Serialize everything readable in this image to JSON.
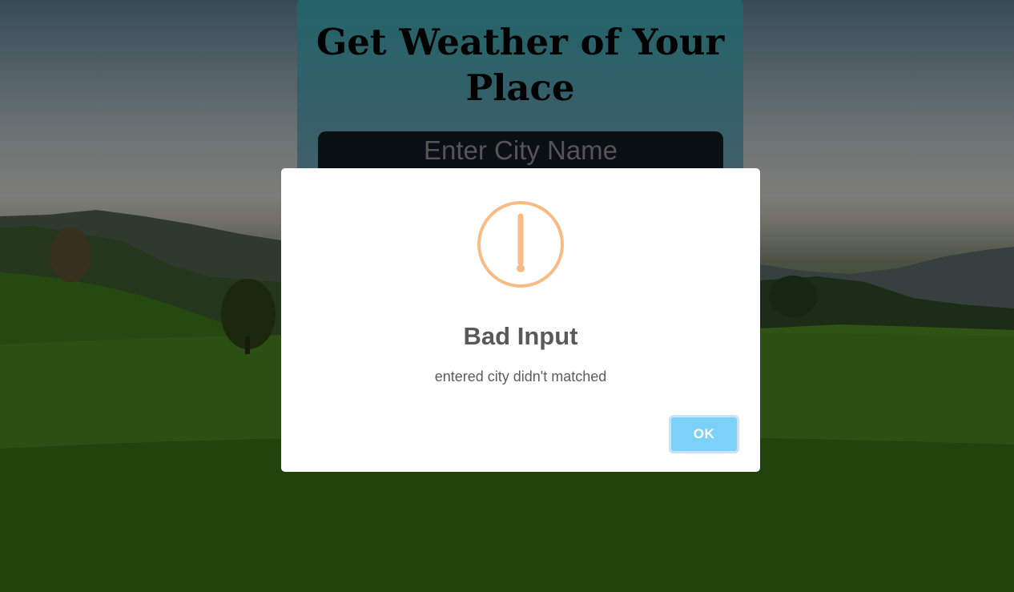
{
  "page": {
    "title": "Get Weather of Your Place"
  },
  "search": {
    "placeholder": "Enter City Name"
  },
  "alert": {
    "icon": "warning-icon",
    "title": "Bad Input",
    "text": "entered city didn't matched",
    "ok_label": "OK"
  },
  "colors": {
    "icon_stroke": "#f8bb86",
    "ok_button": "#7cd1f9",
    "card_top": "#3aa7b0"
  }
}
